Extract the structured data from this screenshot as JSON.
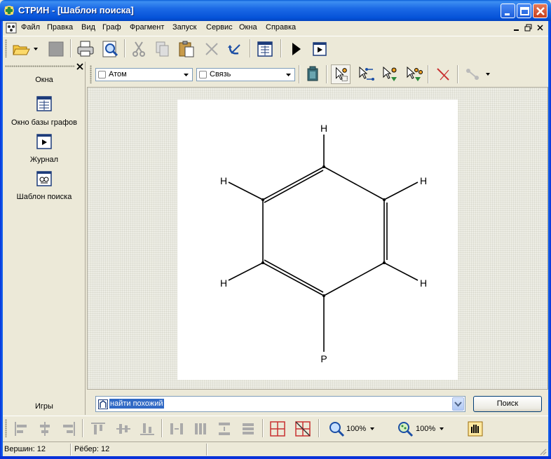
{
  "window": {
    "title": "СТРИН - [Шаблон поиска]"
  },
  "menu": {
    "items": [
      "Файл",
      "Правка",
      "Вид",
      "Граф",
      "Фрагмент",
      "Запуск",
      "Сервис",
      "Окна",
      "Справка"
    ]
  },
  "left_panel": {
    "header": "Окна",
    "items": [
      {
        "label": "Окно базы графов",
        "icon": "graph-db-window-icon"
      },
      {
        "label": "Журнал",
        "icon": "journal-icon"
      },
      {
        "label": "Шаблон поиска",
        "icon": "search-template-icon"
      }
    ],
    "footer": "Игры"
  },
  "editor": {
    "atom_combo": "Атом",
    "bond_combo": "Связь"
  },
  "molecule": {
    "atoms": [
      "H",
      "H",
      "H",
      "H",
      "H",
      "P"
    ]
  },
  "search": {
    "mode_value": "найти похожий",
    "button_label": "Поиск"
  },
  "zoom": {
    "zoom1": "100%",
    "zoom2": "100%"
  },
  "status": {
    "vertices": "Вершин: 12",
    "edges": "Рёбер: 12"
  },
  "colors": {
    "accent_blue": "#0a5fd8",
    "window_bg": "#ece9d8",
    "selection": "#316ac5"
  }
}
